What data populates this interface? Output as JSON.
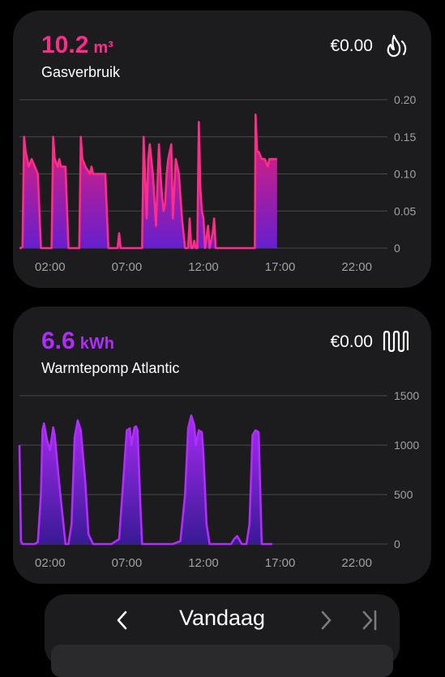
{
  "cards": [
    {
      "value": "10.2",
      "unit": "m³",
      "label": "Gasverbruik",
      "price": "€0.00",
      "icon": "flame-icon",
      "accent": "#ff2d8a",
      "chart_data": {
        "type": "area",
        "x_ticks": [
          "02:00",
          "07:00",
          "12:00",
          "17:00",
          "22:00"
        ],
        "y_ticks": [
          "0.20",
          "0.15",
          "0.10",
          "0.05",
          "0"
        ],
        "ylim": [
          0,
          0.2
        ],
        "xlim_hours": [
          0,
          24
        ],
        "gradient": [
          "#ff1f6e",
          "#6a1fd8"
        ],
        "x": [
          0.0,
          0.1,
          0.2,
          0.3,
          0.4,
          0.6,
          0.8,
          1.0,
          1.2,
          1.4,
          1.6,
          1.8,
          2.0,
          2.1,
          2.2,
          2.3,
          2.5,
          2.6,
          2.7,
          2.8,
          3.0,
          3.2,
          3.4,
          3.6,
          3.8,
          3.9,
          4.0,
          4.1,
          4.3,
          4.6,
          4.7,
          4.8,
          4.9,
          5.0,
          5.2,
          5.4,
          5.6,
          5.8,
          6.0,
          6.2,
          6.4,
          6.5,
          6.6,
          6.8,
          7.0,
          7.5,
          8.0,
          8.1,
          8.3,
          8.4,
          8.5,
          8.7,
          8.9,
          9.1,
          9.2,
          9.3,
          9.4,
          9.5,
          9.6,
          9.7,
          9.8,
          9.9,
          10.0,
          10.2,
          10.3,
          10.4,
          10.6,
          10.8,
          11.0,
          11.1,
          11.2,
          11.3,
          11.4,
          11.5,
          11.6,
          11.7,
          11.8,
          11.9,
          12.0,
          12.1,
          12.3,
          12.4,
          12.6,
          12.7,
          12.8,
          12.9,
          13.0,
          13.3,
          13.4,
          13.6,
          13.8,
          14.0,
          14.5,
          15.0,
          15.3,
          15.35,
          15.4,
          15.5,
          15.6,
          15.8,
          16.0,
          16.2,
          16.3,
          16.4,
          16.6,
          16.8
        ],
        "values": [
          0.0,
          0.0,
          0.002,
          0.15,
          0.13,
          0.11,
          0.12,
          0.11,
          0.1,
          0.0,
          0.0,
          0.0,
          0.0,
          0.0,
          0.15,
          0.12,
          0.11,
          0.12,
          0.11,
          0.11,
          0.11,
          0.0,
          0.0,
          0.0,
          0.0,
          0.0,
          0.15,
          0.12,
          0.11,
          0.1,
          0.11,
          0.1,
          0.1,
          0.1,
          0.1,
          0.1,
          0.1,
          0.0,
          0.0,
          0.0,
          0.0,
          0.02,
          0.0,
          0.0,
          0.0,
          0.0,
          0.0,
          0.15,
          0.04,
          0.12,
          0.14,
          0.1,
          0.03,
          0.14,
          0.1,
          0.07,
          0.05,
          0.06,
          0.1,
          0.12,
          0.13,
          0.14,
          0.04,
          0.12,
          0.11,
          0.1,
          0.04,
          0.0,
          0.0,
          0.04,
          0.0,
          0.0,
          0.01,
          0.0,
          0.0,
          0.17,
          0.08,
          0.05,
          0.04,
          0.0,
          0.03,
          0.0,
          0.02,
          0.04,
          0.0,
          0.0,
          0.0,
          0.0,
          0.0,
          0.0,
          0.0,
          0.0,
          0.0,
          0.0,
          0.0,
          0.0,
          0.18,
          0.13,
          0.13,
          0.12,
          0.12,
          0.11,
          0.12,
          0.12,
          0.12,
          0.12
        ]
      }
    },
    {
      "value": "6.6",
      "unit": "kWh",
      "label": "Warmtepomp Atlantic",
      "price": "€0.00",
      "icon": "radiator-icon",
      "accent": "#b02cff",
      "chart_data": {
        "type": "area",
        "x_ticks": [
          "02:00",
          "07:00",
          "12:00",
          "17:00",
          "22:00"
        ],
        "y_ticks": [
          "1500",
          "1000",
          "500",
          "0"
        ],
        "ylim": [
          0,
          1500
        ],
        "xlim_hours": [
          0,
          24
        ],
        "gradient": [
          "#b02cff",
          "#3a1a9a"
        ],
        "x": [
          0.0,
          0.1,
          0.2,
          0.3,
          0.6,
          1.0,
          1.2,
          1.4,
          1.5,
          1.6,
          1.8,
          2.0,
          2.2,
          2.3,
          2.6,
          3.0,
          3.2,
          3.4,
          3.6,
          3.8,
          4.0,
          4.3,
          4.5,
          4.8,
          5.0,
          6.0,
          6.5,
          6.8,
          7.0,
          7.2,
          7.3,
          7.5,
          7.6,
          7.7,
          7.9,
          8.0,
          8.2,
          8.4,
          8.6,
          8.8,
          9.0,
          9.5,
          10.0,
          10.5,
          10.8,
          11.0,
          11.2,
          11.4,
          11.5,
          11.7,
          11.9,
          12.0,
          12.2,
          12.4,
          12.6,
          13.0,
          13.5,
          13.8,
          14.0,
          14.2,
          14.5,
          14.8,
          15.0,
          15.2,
          15.4,
          15.6,
          15.8,
          16.0,
          16.5
        ],
        "values": [
          1000,
          30,
          0,
          0,
          0,
          0,
          20,
          500,
          1150,
          1220,
          1050,
          950,
          1180,
          1100,
          600,
          0,
          0,
          200,
          1080,
          1250,
          1150,
          620,
          100,
          0,
          0,
          0,
          50,
          700,
          1150,
          1170,
          1000,
          1180,
          1190,
          1150,
          350,
          0,
          0,
          0,
          0,
          0,
          0,
          0,
          0,
          30,
          500,
          1170,
          1300,
          1200,
          1000,
          1150,
          1130,
          900,
          200,
          0,
          0,
          0,
          0,
          0,
          50,
          80,
          0,
          0,
          200,
          1100,
          1150,
          1130,
          0,
          0,
          0
        ]
      }
    }
  ],
  "nav": {
    "title": "Vandaag",
    "prev_icon": "chevron-left-icon",
    "next_icon": "chevron-right-icon",
    "last_icon": "skip-to-end-icon"
  }
}
